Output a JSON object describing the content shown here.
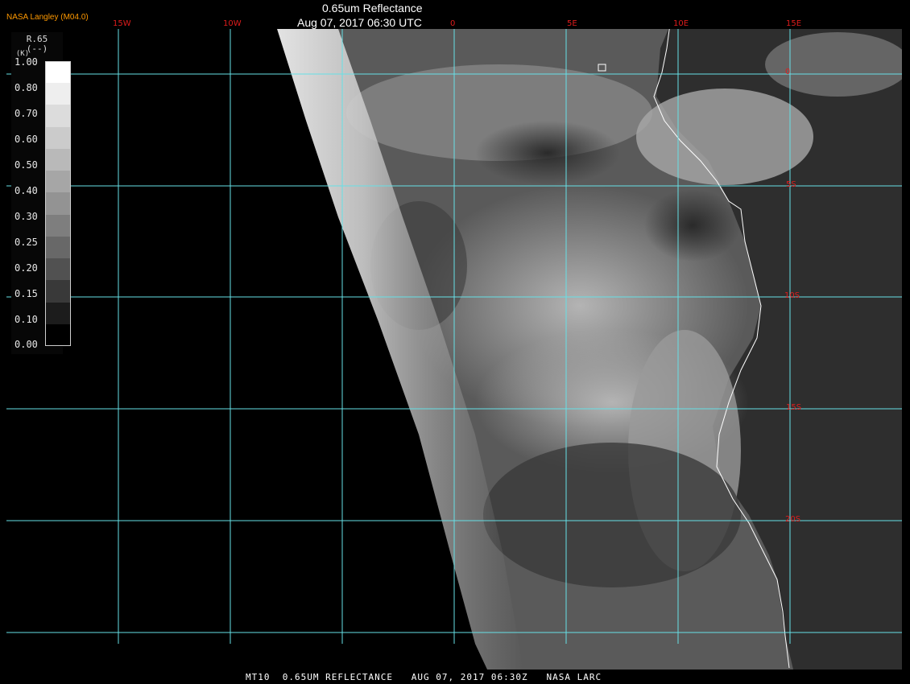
{
  "header": {
    "title": "0.65um Reflectance",
    "datetime": "Aug 07, 2017 06:30 UTC",
    "brand": "NASA Langley (M04.0)"
  },
  "footer": {
    "text": "MT10  0.65UM REFLECTANCE   AUG 07, 2017 06:30Z   NASA LARC"
  },
  "legend": {
    "title_line1": "R.65",
    "title_line2": "(--)",
    "unit_mark": "(K)",
    "ticks": [
      "1.00",
      "0.80",
      "0.70",
      "0.60",
      "0.50",
      "0.40",
      "0.30",
      "0.25",
      "0.20",
      "0.15",
      "0.10",
      "0.00"
    ],
    "swatch_colors": [
      "#ffffff",
      "#eeeeee",
      "#dcdcdc",
      "#cbcbcb",
      "#b9b9b9",
      "#a6a6a6",
      "#939393",
      "#7e7e7e",
      "#686868",
      "#515151",
      "#393939",
      "#1c1c1c",
      "#000000"
    ]
  },
  "grid": {
    "color": "#66e0e6",
    "lon_labels": [
      "15W",
      "10W",
      "0",
      "5E",
      "10E",
      "15E"
    ],
    "lat_labels": [
      "0",
      "5S",
      "10S",
      "15S",
      "20S"
    ]
  },
  "map": {
    "space_color": "#0b0b0b",
    "coast_color": "#ffffff",
    "label_color": "#e01c1c"
  }
}
